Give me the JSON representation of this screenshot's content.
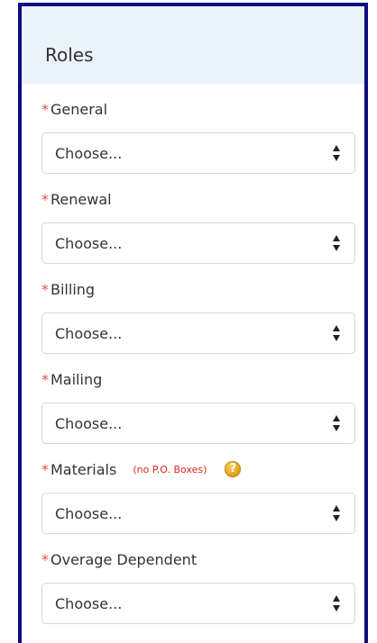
{
  "panel": {
    "title": "Roles",
    "border_color": "#0d0d80",
    "header_background": "#eaf2fb"
  },
  "required_marker": "*",
  "required_color": "#d9534f",
  "fields": [
    {
      "label": "General",
      "value": "Choose..."
    },
    {
      "label": "Renewal",
      "value": "Choose..."
    },
    {
      "label": "Billing",
      "value": "Choose..."
    },
    {
      "label": "Mailing",
      "value": "Choose..."
    },
    {
      "label": "Materials",
      "note": "(no P.O. Boxes)",
      "help_icon": "help-question-icon",
      "value": "Choose..."
    },
    {
      "label": "Overage Dependent",
      "value": "Choose..."
    }
  ],
  "icons": {
    "select_arrow": "up-down-caret-icon",
    "help": "help-question-icon"
  }
}
